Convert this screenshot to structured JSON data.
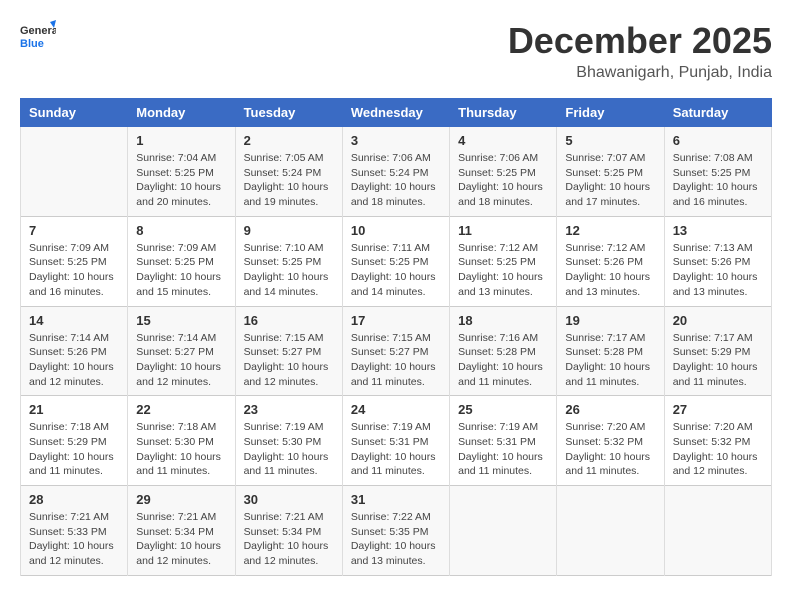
{
  "logo": {
    "line1": "General",
    "line2": "Blue"
  },
  "title": "December 2025",
  "subtitle": "Bhawanigarh, Punjab, India",
  "days_header": [
    "Sunday",
    "Monday",
    "Tuesday",
    "Wednesday",
    "Thursday",
    "Friday",
    "Saturday"
  ],
  "weeks": [
    [
      {
        "day": "",
        "info": ""
      },
      {
        "day": "1",
        "info": "Sunrise: 7:04 AM\nSunset: 5:25 PM\nDaylight: 10 hours\nand 20 minutes."
      },
      {
        "day": "2",
        "info": "Sunrise: 7:05 AM\nSunset: 5:24 PM\nDaylight: 10 hours\nand 19 minutes."
      },
      {
        "day": "3",
        "info": "Sunrise: 7:06 AM\nSunset: 5:24 PM\nDaylight: 10 hours\nand 18 minutes."
      },
      {
        "day": "4",
        "info": "Sunrise: 7:06 AM\nSunset: 5:25 PM\nDaylight: 10 hours\nand 18 minutes."
      },
      {
        "day": "5",
        "info": "Sunrise: 7:07 AM\nSunset: 5:25 PM\nDaylight: 10 hours\nand 17 minutes."
      },
      {
        "day": "6",
        "info": "Sunrise: 7:08 AM\nSunset: 5:25 PM\nDaylight: 10 hours\nand 16 minutes."
      }
    ],
    [
      {
        "day": "7",
        "info": "Sunrise: 7:09 AM\nSunset: 5:25 PM\nDaylight: 10 hours\nand 16 minutes."
      },
      {
        "day": "8",
        "info": "Sunrise: 7:09 AM\nSunset: 5:25 PM\nDaylight: 10 hours\nand 15 minutes."
      },
      {
        "day": "9",
        "info": "Sunrise: 7:10 AM\nSunset: 5:25 PM\nDaylight: 10 hours\nand 14 minutes."
      },
      {
        "day": "10",
        "info": "Sunrise: 7:11 AM\nSunset: 5:25 PM\nDaylight: 10 hours\nand 14 minutes."
      },
      {
        "day": "11",
        "info": "Sunrise: 7:12 AM\nSunset: 5:25 PM\nDaylight: 10 hours\nand 13 minutes."
      },
      {
        "day": "12",
        "info": "Sunrise: 7:12 AM\nSunset: 5:26 PM\nDaylight: 10 hours\nand 13 minutes."
      },
      {
        "day": "13",
        "info": "Sunrise: 7:13 AM\nSunset: 5:26 PM\nDaylight: 10 hours\nand 13 minutes."
      }
    ],
    [
      {
        "day": "14",
        "info": "Sunrise: 7:14 AM\nSunset: 5:26 PM\nDaylight: 10 hours\nand 12 minutes."
      },
      {
        "day": "15",
        "info": "Sunrise: 7:14 AM\nSunset: 5:27 PM\nDaylight: 10 hours\nand 12 minutes."
      },
      {
        "day": "16",
        "info": "Sunrise: 7:15 AM\nSunset: 5:27 PM\nDaylight: 10 hours\nand 12 minutes."
      },
      {
        "day": "17",
        "info": "Sunrise: 7:15 AM\nSunset: 5:27 PM\nDaylight: 10 hours\nand 11 minutes."
      },
      {
        "day": "18",
        "info": "Sunrise: 7:16 AM\nSunset: 5:28 PM\nDaylight: 10 hours\nand 11 minutes."
      },
      {
        "day": "19",
        "info": "Sunrise: 7:17 AM\nSunset: 5:28 PM\nDaylight: 10 hours\nand 11 minutes."
      },
      {
        "day": "20",
        "info": "Sunrise: 7:17 AM\nSunset: 5:29 PM\nDaylight: 10 hours\nand 11 minutes."
      }
    ],
    [
      {
        "day": "21",
        "info": "Sunrise: 7:18 AM\nSunset: 5:29 PM\nDaylight: 10 hours\nand 11 minutes."
      },
      {
        "day": "22",
        "info": "Sunrise: 7:18 AM\nSunset: 5:30 PM\nDaylight: 10 hours\nand 11 minutes."
      },
      {
        "day": "23",
        "info": "Sunrise: 7:19 AM\nSunset: 5:30 PM\nDaylight: 10 hours\nand 11 minutes."
      },
      {
        "day": "24",
        "info": "Sunrise: 7:19 AM\nSunset: 5:31 PM\nDaylight: 10 hours\nand 11 minutes."
      },
      {
        "day": "25",
        "info": "Sunrise: 7:19 AM\nSunset: 5:31 PM\nDaylight: 10 hours\nand 11 minutes."
      },
      {
        "day": "26",
        "info": "Sunrise: 7:20 AM\nSunset: 5:32 PM\nDaylight: 10 hours\nand 11 minutes."
      },
      {
        "day": "27",
        "info": "Sunrise: 7:20 AM\nSunset: 5:32 PM\nDaylight: 10 hours\nand 12 minutes."
      }
    ],
    [
      {
        "day": "28",
        "info": "Sunrise: 7:21 AM\nSunset: 5:33 PM\nDaylight: 10 hours\nand 12 minutes."
      },
      {
        "day": "29",
        "info": "Sunrise: 7:21 AM\nSunset: 5:34 PM\nDaylight: 10 hours\nand 12 minutes."
      },
      {
        "day": "30",
        "info": "Sunrise: 7:21 AM\nSunset: 5:34 PM\nDaylight: 10 hours\nand 12 minutes."
      },
      {
        "day": "31",
        "info": "Sunrise: 7:22 AM\nSunset: 5:35 PM\nDaylight: 10 hours\nand 13 minutes."
      },
      {
        "day": "",
        "info": ""
      },
      {
        "day": "",
        "info": ""
      },
      {
        "day": "",
        "info": ""
      }
    ]
  ]
}
